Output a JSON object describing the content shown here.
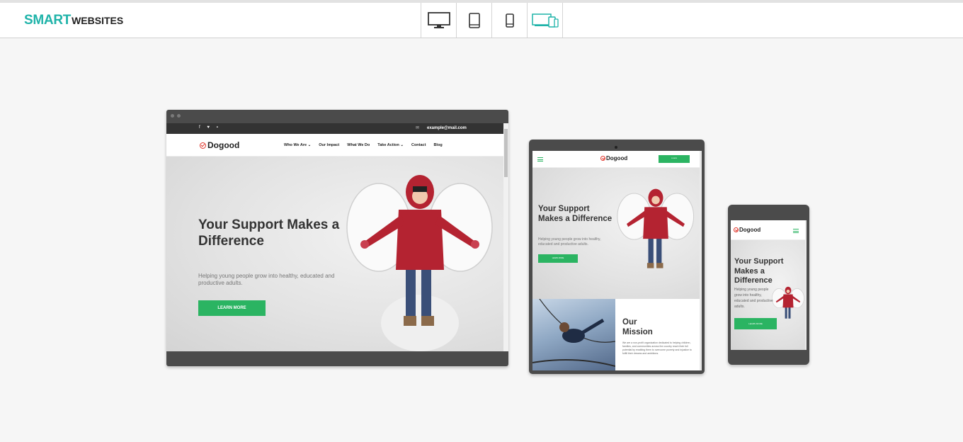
{
  "app": {
    "logo_main": "SMART",
    "logo_sub": "WEBSITES"
  },
  "toolbar": {
    "devices": [
      {
        "icon": "desktop-icon",
        "active": false
      },
      {
        "icon": "tablet-icon",
        "active": false
      },
      {
        "icon": "phone-icon",
        "active": false
      },
      {
        "icon": "all-devices-icon",
        "active": true
      }
    ],
    "active_color": "#1fb3a9"
  },
  "site": {
    "brand_name": "Dogood",
    "email": "example@mail.com",
    "nav": [
      "Who We Are ⌄",
      "Our Impact",
      "What We Do",
      "Take Action ⌄",
      "Contact",
      "Blog"
    ],
    "hero_title": "Your Support Makes a Difference",
    "hero_sub": "Helping young people grow into healthy, educated and productive adults.",
    "cta": "LEARN MORE",
    "donate": "DONATE",
    "mission_title": "Our Mission",
    "mission_text": "We are a non-profit organization dedicated to helping children, families, and communities across the country reach their full potential by enabling them to overcome poverty and injustice to fulfill their dreams and ambitions.",
    "accent": "#2bb462",
    "brand_red": "#e0352b"
  }
}
